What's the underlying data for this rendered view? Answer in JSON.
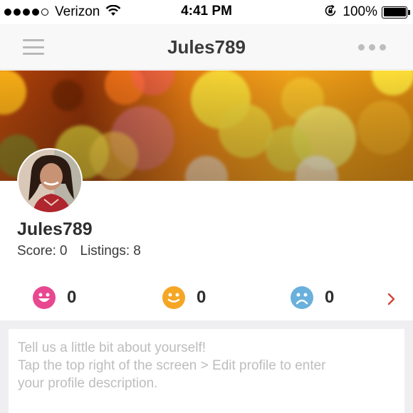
{
  "status_bar": {
    "carrier": "Verizon",
    "time": "4:41 PM",
    "battery": "100%",
    "icons": [
      "signal-dots-icon",
      "wifi-icon",
      "orientation-lock-icon",
      "battery-icon"
    ]
  },
  "nav": {
    "title": "Jules789",
    "left_icon": "menu-icon",
    "right_icon": "more-options-icon"
  },
  "profile": {
    "username": "Jules789",
    "score_label": "Score:",
    "score_value": "0",
    "listings_label": "Listings:",
    "listings_value": "8"
  },
  "feedback": [
    {
      "icon": "happy-face-icon",
      "count": "0",
      "color": "#e8488f"
    },
    {
      "icon": "neutral-face-icon",
      "count": "0",
      "color": "#f5a623"
    },
    {
      "icon": "sad-face-icon",
      "count": "0",
      "color": "#6ab0dd"
    }
  ],
  "feedback_chevron_color": "#d0463a",
  "description": {
    "line1": "Tell us a little bit about yourself!",
    "line2": "Tap the top right of the screen > Edit profile to enter",
    "line3": "your profile description."
  }
}
